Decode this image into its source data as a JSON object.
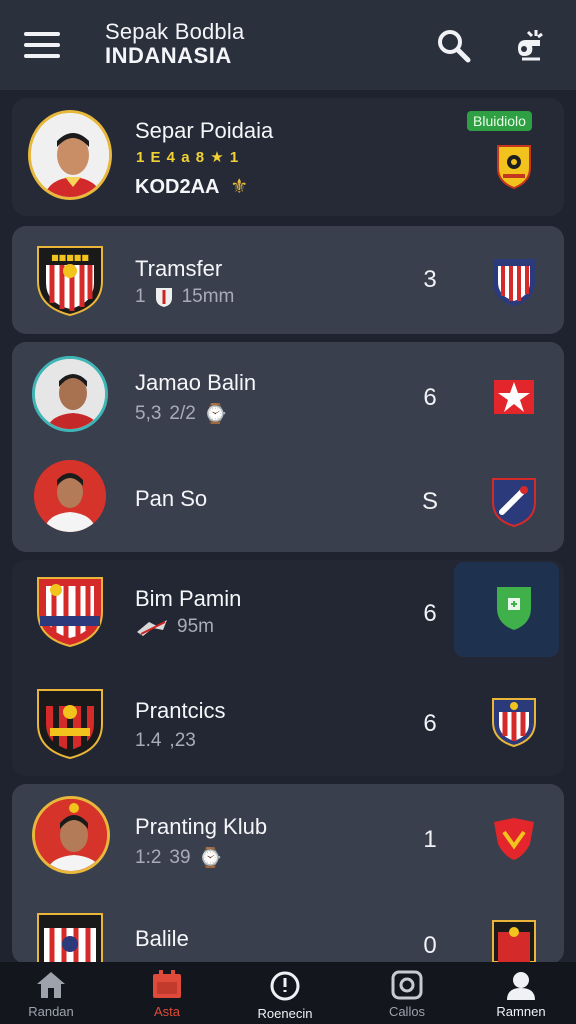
{
  "header": {
    "title_line1": "Sepak Bodbla",
    "title_line2": "INDANASIA",
    "menu_icon": "hamburger-icon",
    "search_icon": "search-icon",
    "tool_icon": "whistle-icon"
  },
  "featured": {
    "name": "Separ Poidaia",
    "badge": "Bluidiolo",
    "stars": "1 E 4 a 8 ★ 1",
    "code": "KOD2AA"
  },
  "cards": [
    {
      "name": "Tramsfer",
      "meta": "1",
      "meta2": "15mm",
      "value": "3"
    },
    {
      "name": "Jamao Balin",
      "meta": "5,3",
      "meta2": "2/2",
      "value": "6"
    },
    {
      "name": "Pan So",
      "meta": "",
      "meta2": "",
      "value": "S"
    },
    {
      "name": "Bim Pamin",
      "meta": "",
      "meta2": "95m",
      "value": "6"
    },
    {
      "name": "Prantcics",
      "meta": "1.4",
      "meta2": ",23",
      "value": "6"
    },
    {
      "name": "Pranting Klub",
      "meta": "1:2",
      "meta2": "39",
      "value": "1"
    },
    {
      "name": "Balile",
      "meta": "",
      "meta2": "",
      "value": "0"
    }
  ],
  "nav": [
    {
      "label": "Randan",
      "icon": "home-icon"
    },
    {
      "label": "Asta",
      "icon": "calendar-icon"
    },
    {
      "label": "Roenecin",
      "icon": "compass-icon"
    },
    {
      "label": "Callos",
      "icon": "camera-icon"
    },
    {
      "label": "Ramnen",
      "icon": "profile-icon"
    }
  ],
  "colors": {
    "accent": "#e04a3a",
    "badge": "#2ea043",
    "highlight": "#1e3250"
  }
}
